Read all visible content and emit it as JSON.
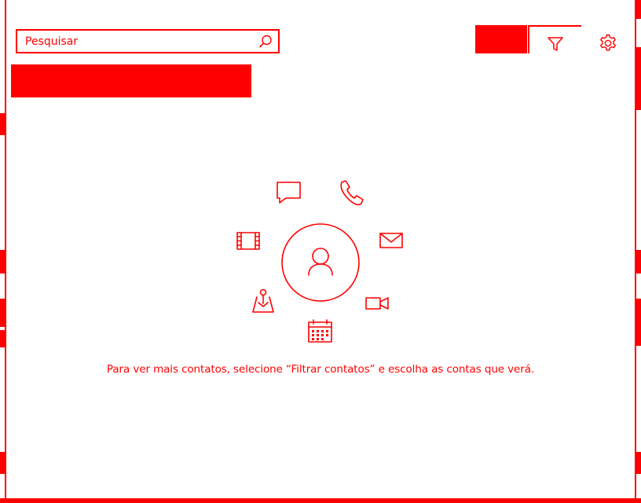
{
  "search": {
    "placeholder": "Pesquisar",
    "value": ""
  },
  "toolbar": {
    "icons": {
      "search": "search-icon",
      "filter": "filter-icon",
      "settings": "gear-icon"
    }
  },
  "empty_state": {
    "message": "Para ver mais contatos, selecione “Filtrar contatos” e escolha as contas que verá.",
    "icons": [
      "chat-icon",
      "phone-icon",
      "mail-icon",
      "video-call-icon",
      "calendar-icon",
      "map-icon",
      "film-icon",
      "person-icon"
    ]
  },
  "colors": {
    "accent": "#ff0000",
    "background": "#ffffff"
  }
}
